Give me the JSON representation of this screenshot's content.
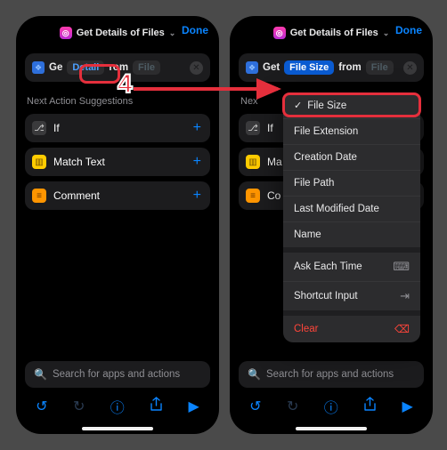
{
  "colors": {
    "accent": "#0a84ff",
    "danger": "#ff453a",
    "annotation": "#e52f3c"
  },
  "left": {
    "header": {
      "title": "Get Details of Files",
      "done": "Done",
      "icon": "details-icon"
    },
    "action": {
      "prefix": "Ge",
      "token": "Detail",
      "mid": "rom",
      "file_token": "File"
    },
    "section_label": "Next Action Suggestions",
    "suggestions": [
      {
        "icon": "branch-icon",
        "label": "If"
      },
      {
        "icon": "match-icon",
        "label": "Match Text"
      },
      {
        "icon": "comment-icon",
        "label": "Comment"
      }
    ],
    "search_placeholder": "Search for apps and actions",
    "toolbar_icons": [
      "undo-icon",
      "redo-icon",
      "info-icon",
      "share-icon",
      "play-icon"
    ]
  },
  "right": {
    "header": {
      "title": "Get Details of Files",
      "done": "Done",
      "icon": "details-icon"
    },
    "action": {
      "prefix": "Get",
      "token": "File Size",
      "mid": "from",
      "file_token": "File"
    },
    "section_label_truncated": "Nex",
    "suggestions": [
      {
        "icon": "branch-icon",
        "label": "If"
      },
      {
        "icon": "match-icon",
        "label": "Ma"
      },
      {
        "icon": "comment-icon",
        "label": "Co"
      }
    ],
    "popover": {
      "selected": "File Size",
      "options": [
        "File Size",
        "File Extension",
        "Creation Date",
        "File Path",
        "Last Modified Date",
        "Name"
      ],
      "special": [
        {
          "label": "Ask Each Time",
          "tail_icon": "ask-icon"
        },
        {
          "label": "Shortcut Input",
          "tail_icon": "input-icon"
        }
      ],
      "clear": "Clear"
    },
    "search_placeholder": "Search for apps and actions",
    "toolbar_icons": [
      "undo-icon",
      "redo-icon",
      "info-icon",
      "share-icon",
      "play-icon"
    ]
  },
  "annotation": {
    "number": "4"
  }
}
